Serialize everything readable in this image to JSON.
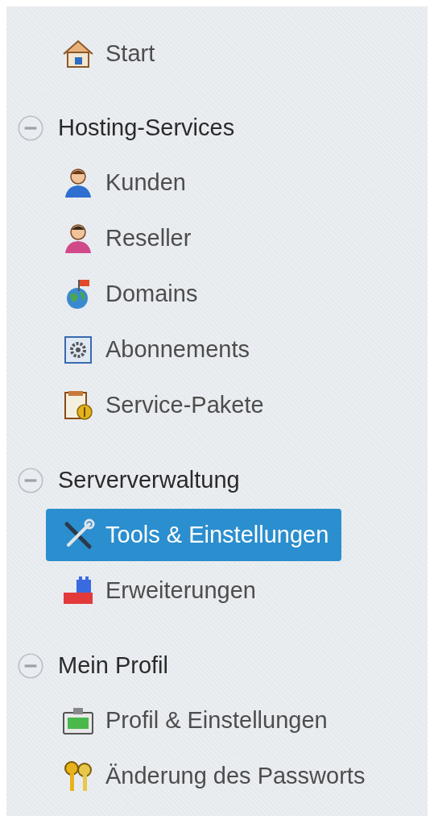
{
  "top_items": [
    {
      "label": "Start",
      "selected": false
    }
  ],
  "sections": [
    {
      "title": "Hosting-Services",
      "expanded": true,
      "items": [
        {
          "label": "Kunden",
          "selected": false
        },
        {
          "label": "Reseller",
          "selected": false
        },
        {
          "label": "Domains",
          "selected": false
        },
        {
          "label": "Abonnements",
          "selected": false
        },
        {
          "label": "Service-Pakete",
          "selected": false
        }
      ]
    },
    {
      "title": "Serververwaltung",
      "expanded": true,
      "items": [
        {
          "label": "Tools & Einstellungen",
          "selected": true
        },
        {
          "label": "Erweiterungen",
          "selected": false
        }
      ]
    },
    {
      "title": "Mein Profil",
      "expanded": true,
      "items": [
        {
          "label": "Profil & Einstellungen",
          "selected": false
        },
        {
          "label": "Änderung des Passworts",
          "selected": false
        }
      ]
    }
  ]
}
